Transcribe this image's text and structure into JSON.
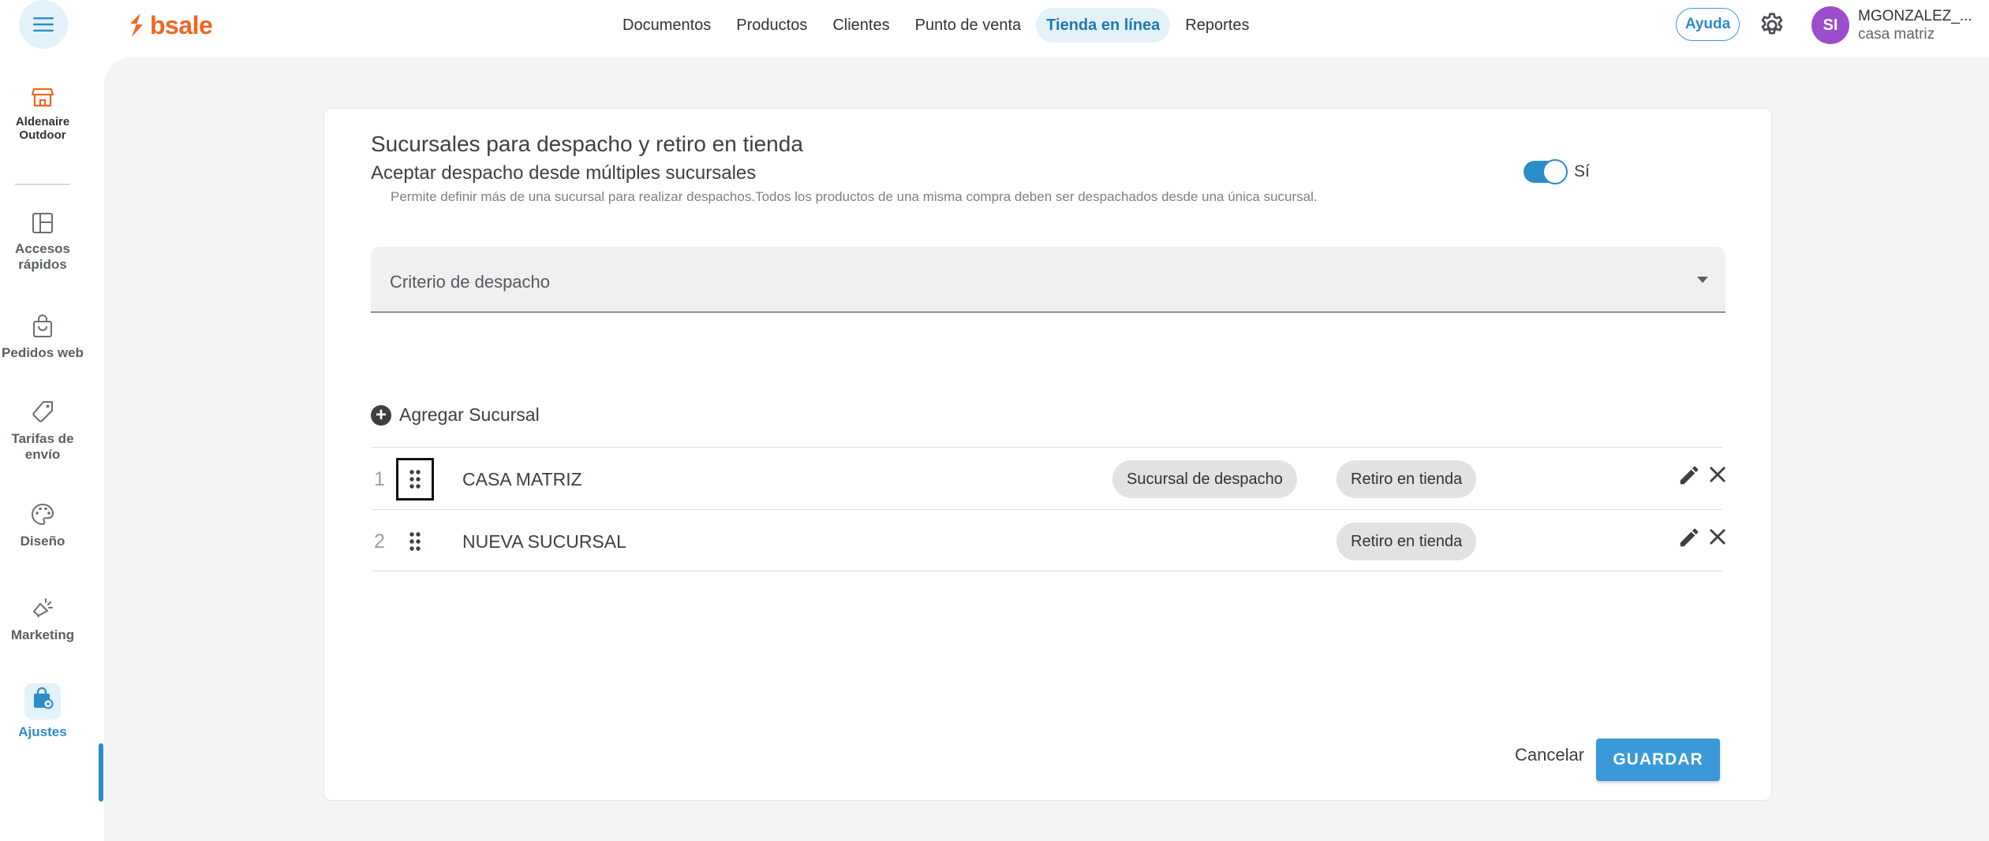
{
  "topbar": {
    "brand": "bsale",
    "nav": [
      {
        "label": "Documentos",
        "active": false
      },
      {
        "label": "Productos",
        "active": false
      },
      {
        "label": "Clientes",
        "active": false
      },
      {
        "label": "Punto de venta",
        "active": false
      },
      {
        "label": "Tienda en línea",
        "active": true
      },
      {
        "label": "Reportes",
        "active": false
      }
    ],
    "help_label": "Ayuda",
    "avatar_initials": "SI",
    "user_name": "MGONZALEZ_...",
    "user_branch": "casa matriz"
  },
  "sidebar": {
    "store_name_line1": "Aldenaire",
    "store_name_line2": "Outdoor",
    "items": [
      {
        "label1": "Accesos",
        "label2": "rápidos",
        "icon": "dashboard-icon"
      },
      {
        "label1": "Pedidos web",
        "label2": "",
        "icon": "shopping-bag-icon"
      },
      {
        "label1": "Tarifas de",
        "label2": "envío",
        "icon": "tag-icon"
      },
      {
        "label1": "Diseño",
        "label2": "",
        "icon": "palette-icon"
      },
      {
        "label1": "Marketing",
        "label2": "",
        "icon": "megaphone-icon"
      },
      {
        "label1": "Ajustes",
        "label2": "",
        "icon": "settings-bag-icon",
        "active": true
      }
    ]
  },
  "main": {
    "title": "Sucursales para despacho y retiro en tienda",
    "multi_label": "Aceptar despacho desde múltiples sucursales",
    "multi_desc": "Permite definir más de una sucursal para realizar despachos.Todos los productos de una misma compra deben ser despachados desde una única sucursal.",
    "toggle_on": true,
    "toggle_label": "Sí",
    "criteria_placeholder": "Criterio de despacho",
    "add_branch_label": "Agregar Sucursal",
    "branches": [
      {
        "index": "1",
        "name": "CASA MATRIZ",
        "dispatch_chip": "Sucursal de despacho",
        "pickup_chip": "Retiro en tienda"
      },
      {
        "index": "2",
        "name": "NUEVA SUCURSAL",
        "dispatch_chip": "",
        "pickup_chip": "Retiro en tienda"
      }
    ],
    "cancel_label": "Cancelar",
    "save_label": "GUARDAR"
  },
  "colors": {
    "brand_orange": "#f26522",
    "accent_blue": "#2b8cc8",
    "avatar_purple": "#9c4dcc",
    "page_bg": "#f4f4f4"
  }
}
